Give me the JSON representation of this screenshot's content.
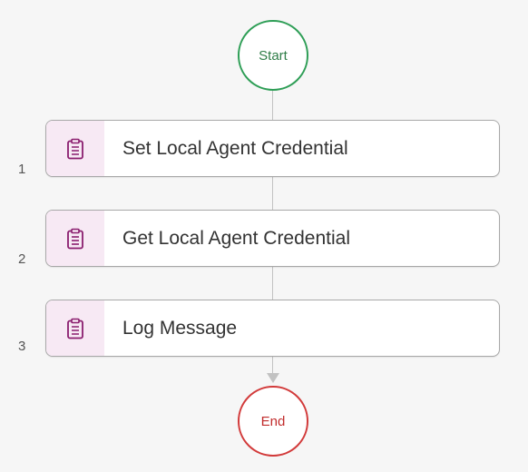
{
  "flow": {
    "start_label": "Start",
    "end_label": "End",
    "steps": [
      {
        "number": "1",
        "label": "Set Local Agent Credential",
        "icon": "clipboard-icon"
      },
      {
        "number": "2",
        "label": "Get Local Agent Credential",
        "icon": "clipboard-icon"
      },
      {
        "number": "3",
        "label": "Log Message",
        "icon": "clipboard-icon"
      }
    ]
  },
  "colors": {
    "start_border": "#2e9e56",
    "end_border": "#d23a3a",
    "icon_tint": "#8a1d6e",
    "icon_bg": "#f7e9f4",
    "connector": "#c2c2c2"
  }
}
